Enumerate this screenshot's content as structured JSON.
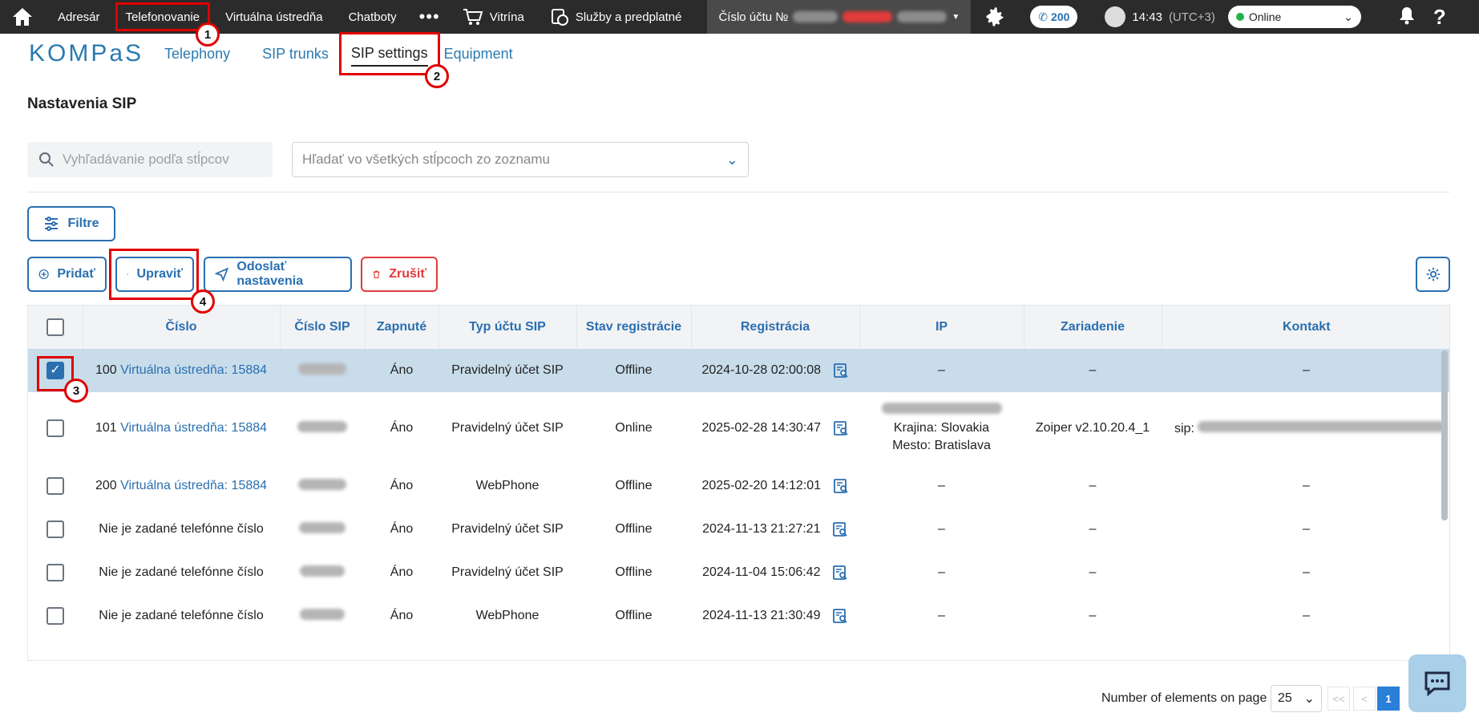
{
  "topbar": {
    "items": [
      "Adresár",
      "Telefonovanie",
      "Virtuálna ústredňa",
      "Chatboty"
    ],
    "more": "•••",
    "store": "Vitrína",
    "services": "Služby a predplatné",
    "account_label": "Číslo účtu №",
    "calls_count": "200",
    "time": "14:43",
    "timezone": "(UTC+3)",
    "status": "Online"
  },
  "subnav": {
    "logo": "KOMPaS",
    "tabs": [
      "Telephony",
      "SIP trunks",
      "SIP settings",
      "Equipment"
    ]
  },
  "markers": [
    "1",
    "2",
    "3",
    "4"
  ],
  "page": {
    "title": "Nastavenia SIP",
    "search_placeholder": "Vyhľadávanie podľa stĺpcov",
    "column_search_placeholder": "Hľadať vo všetkých stĺpcoch zo zoznamu",
    "filters_label": "Filtre",
    "add_label": "Pridať",
    "edit_label": "Upraviť",
    "send_label": "Odoslať nastavenia",
    "delete_label": "Zrušiť"
  },
  "table": {
    "headers": [
      "Číslo",
      "Číslo SIP",
      "Zapnuté",
      "Typ účtu SIP",
      "Stav registrácie",
      "Registrácia",
      "IP",
      "Zariadenie",
      "Kontakt"
    ],
    "rows": [
      {
        "num": "100",
        "link": "Virtuálna ústredňa: 15884",
        "enabled": "Áno",
        "type": "Pravidelný účet SIP",
        "state": "Offline",
        "reg": "2024-10-28 02:00:08",
        "ip": "–",
        "country": "",
        "city": "",
        "device": "–",
        "contact": "–",
        "selected": true
      },
      {
        "num": "101",
        "link": "Virtuálna ústredňa: 15884",
        "enabled": "Áno",
        "type": "Pravidelný účet SIP",
        "state": "Online",
        "reg": "2025-02-28 14:30:47",
        "ip": "",
        "country": "Krajina: Slovakia",
        "city": "Mesto: Bratislava",
        "device": "Zoiper v2.10.20.4_1",
        "contact": "sip:",
        "selected": false
      },
      {
        "num": "200",
        "link": "Virtuálna ústredňa: 15884",
        "enabled": "Áno",
        "type": "WebPhone",
        "state": "Offline",
        "reg": "2025-02-20 14:12:01",
        "ip": "–",
        "country": "",
        "city": "",
        "device": "–",
        "contact": "–",
        "selected": false
      },
      {
        "num": "Nie je zadané telefónne číslo",
        "link": "",
        "enabled": "Áno",
        "type": "Pravidelný účet SIP",
        "state": "Offline",
        "reg": "2024-11-13 21:27:21",
        "ip": "–",
        "country": "",
        "city": "",
        "device": "–",
        "contact": "–",
        "selected": false
      },
      {
        "num": "Nie je zadané telefónne číslo",
        "link": "",
        "enabled": "Áno",
        "type": "Pravidelný účet SIP",
        "state": "Offline",
        "reg": "2024-11-04 15:06:42",
        "ip": "–",
        "country": "",
        "city": "",
        "device": "–",
        "contact": "–",
        "selected": false
      },
      {
        "num": "Nie je zadané telefónne číslo",
        "link": "",
        "enabled": "Áno",
        "type": "WebPhone",
        "state": "Offline",
        "reg": "2024-11-13 21:30:49",
        "ip": "–",
        "country": "",
        "city": "",
        "device": "–",
        "contact": "–",
        "selected": false
      }
    ]
  },
  "pager": {
    "label": "Number of elements on page",
    "page_size": "25",
    "first": "<<",
    "prev": "<",
    "current": "1"
  }
}
